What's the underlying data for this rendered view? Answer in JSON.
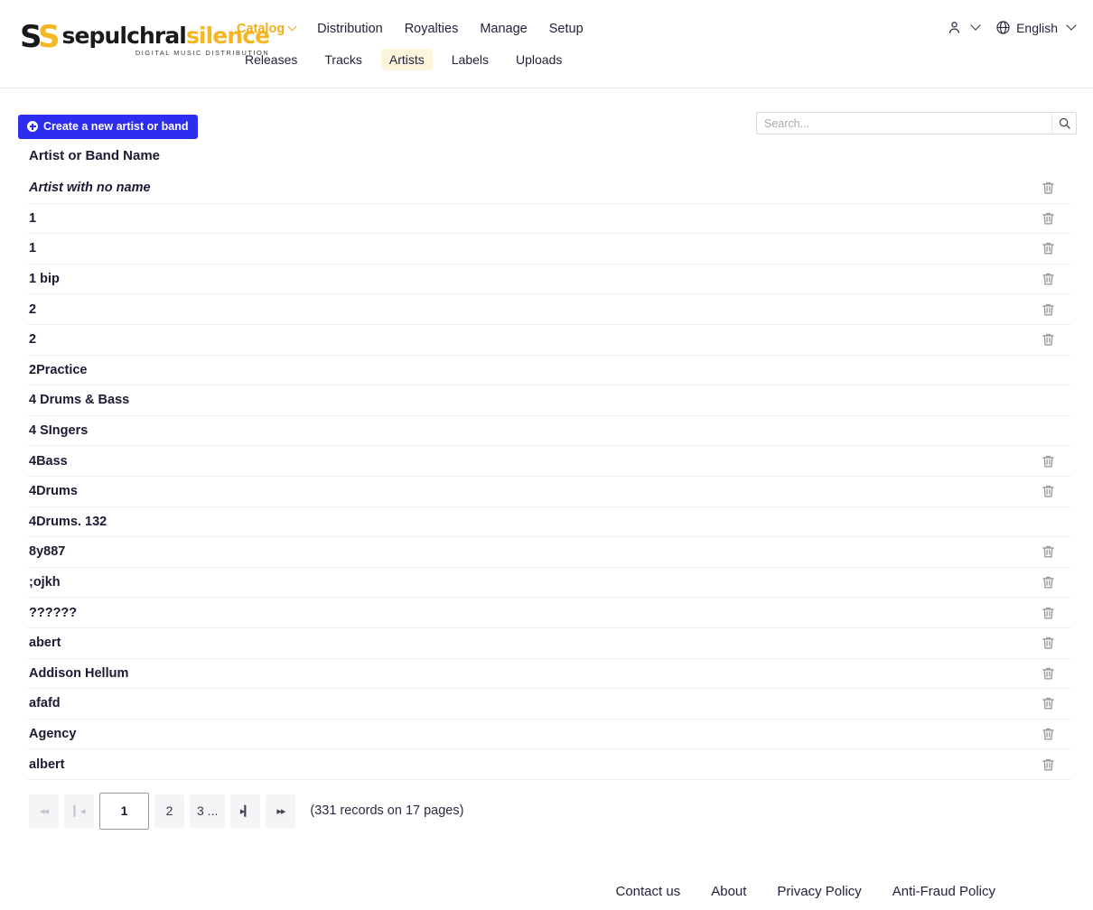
{
  "brand": {
    "mark_left": "S",
    "mark_right": "S",
    "word_left": "sepulchral",
    "word_right": "silence",
    "tagline": "DIGITAL MUSIC DISTRIBUTION",
    "accent_color": "#f5b622"
  },
  "nav": {
    "main": [
      {
        "label": "Catalog",
        "active": true,
        "has_caret": true
      },
      {
        "label": "Distribution",
        "active": false,
        "has_caret": false
      },
      {
        "label": "Royalties",
        "active": false,
        "has_caret": false
      },
      {
        "label": "Manage",
        "active": false,
        "has_caret": false
      },
      {
        "label": "Setup",
        "active": false,
        "has_caret": false
      }
    ],
    "sub": [
      {
        "label": "Releases",
        "active": false
      },
      {
        "label": "Tracks",
        "active": false
      },
      {
        "label": "Artists",
        "active": true
      },
      {
        "label": "Labels",
        "active": false
      },
      {
        "label": "Uploads",
        "active": false
      }
    ]
  },
  "header_right": {
    "account_icon": "user-icon",
    "language_icon": "globe-icon",
    "language_label": "English"
  },
  "toolbar": {
    "create_button": "Create a new artist or band",
    "create_icon": "plus-circle-icon",
    "search_placeholder": "Search...",
    "search_value": "",
    "search_icon": "search-icon"
  },
  "table": {
    "column_header": "Artist or Band Name",
    "delete_icon": "trash-icon",
    "rows": [
      {
        "name": "Artist with no name",
        "italic": true,
        "deletable": true
      },
      {
        "name": "1",
        "italic": false,
        "deletable": true
      },
      {
        "name": "1",
        "italic": false,
        "deletable": true
      },
      {
        "name": "1 bip",
        "italic": false,
        "deletable": true
      },
      {
        "name": "2",
        "italic": false,
        "deletable": true
      },
      {
        "name": "2",
        "italic": false,
        "deletable": true
      },
      {
        "name": "2Practice",
        "italic": false,
        "deletable": false
      },
      {
        "name": "4 Drums & Bass",
        "italic": false,
        "deletable": false
      },
      {
        "name": "4 SIngers",
        "italic": false,
        "deletable": false
      },
      {
        "name": "4Bass",
        "italic": false,
        "deletable": true
      },
      {
        "name": "4Drums",
        "italic": false,
        "deletable": true
      },
      {
        "name": "4Drums. 132",
        "italic": false,
        "deletable": false
      },
      {
        "name": "8y887",
        "italic": false,
        "deletable": true
      },
      {
        "name": ";ojkh",
        "italic": false,
        "deletable": true
      },
      {
        "name": "??????",
        "italic": false,
        "deletable": true
      },
      {
        "name": "abert",
        "italic": false,
        "deletable": true
      },
      {
        "name": "Addison Hellum",
        "italic": false,
        "deletable": true
      },
      {
        "name": "afafd",
        "italic": false,
        "deletable": true
      },
      {
        "name": "Agency",
        "italic": false,
        "deletable": true
      },
      {
        "name": "albert",
        "italic": false,
        "deletable": true
      }
    ]
  },
  "pagination": {
    "first_label": "◂◂",
    "prev_label": "▎◂",
    "pages": [
      {
        "label": "1",
        "current": true
      },
      {
        "label": "2",
        "current": false
      },
      {
        "label": "3 ...",
        "current": false
      }
    ],
    "next_label": "▸▎",
    "last_label": "▸▸",
    "info": "(331 records on 17 pages)"
  },
  "footer": {
    "links": [
      {
        "label": "Contact us"
      },
      {
        "label": "About"
      },
      {
        "label": "Privacy Policy"
      },
      {
        "label": "Anti-Fraud Policy"
      }
    ]
  }
}
